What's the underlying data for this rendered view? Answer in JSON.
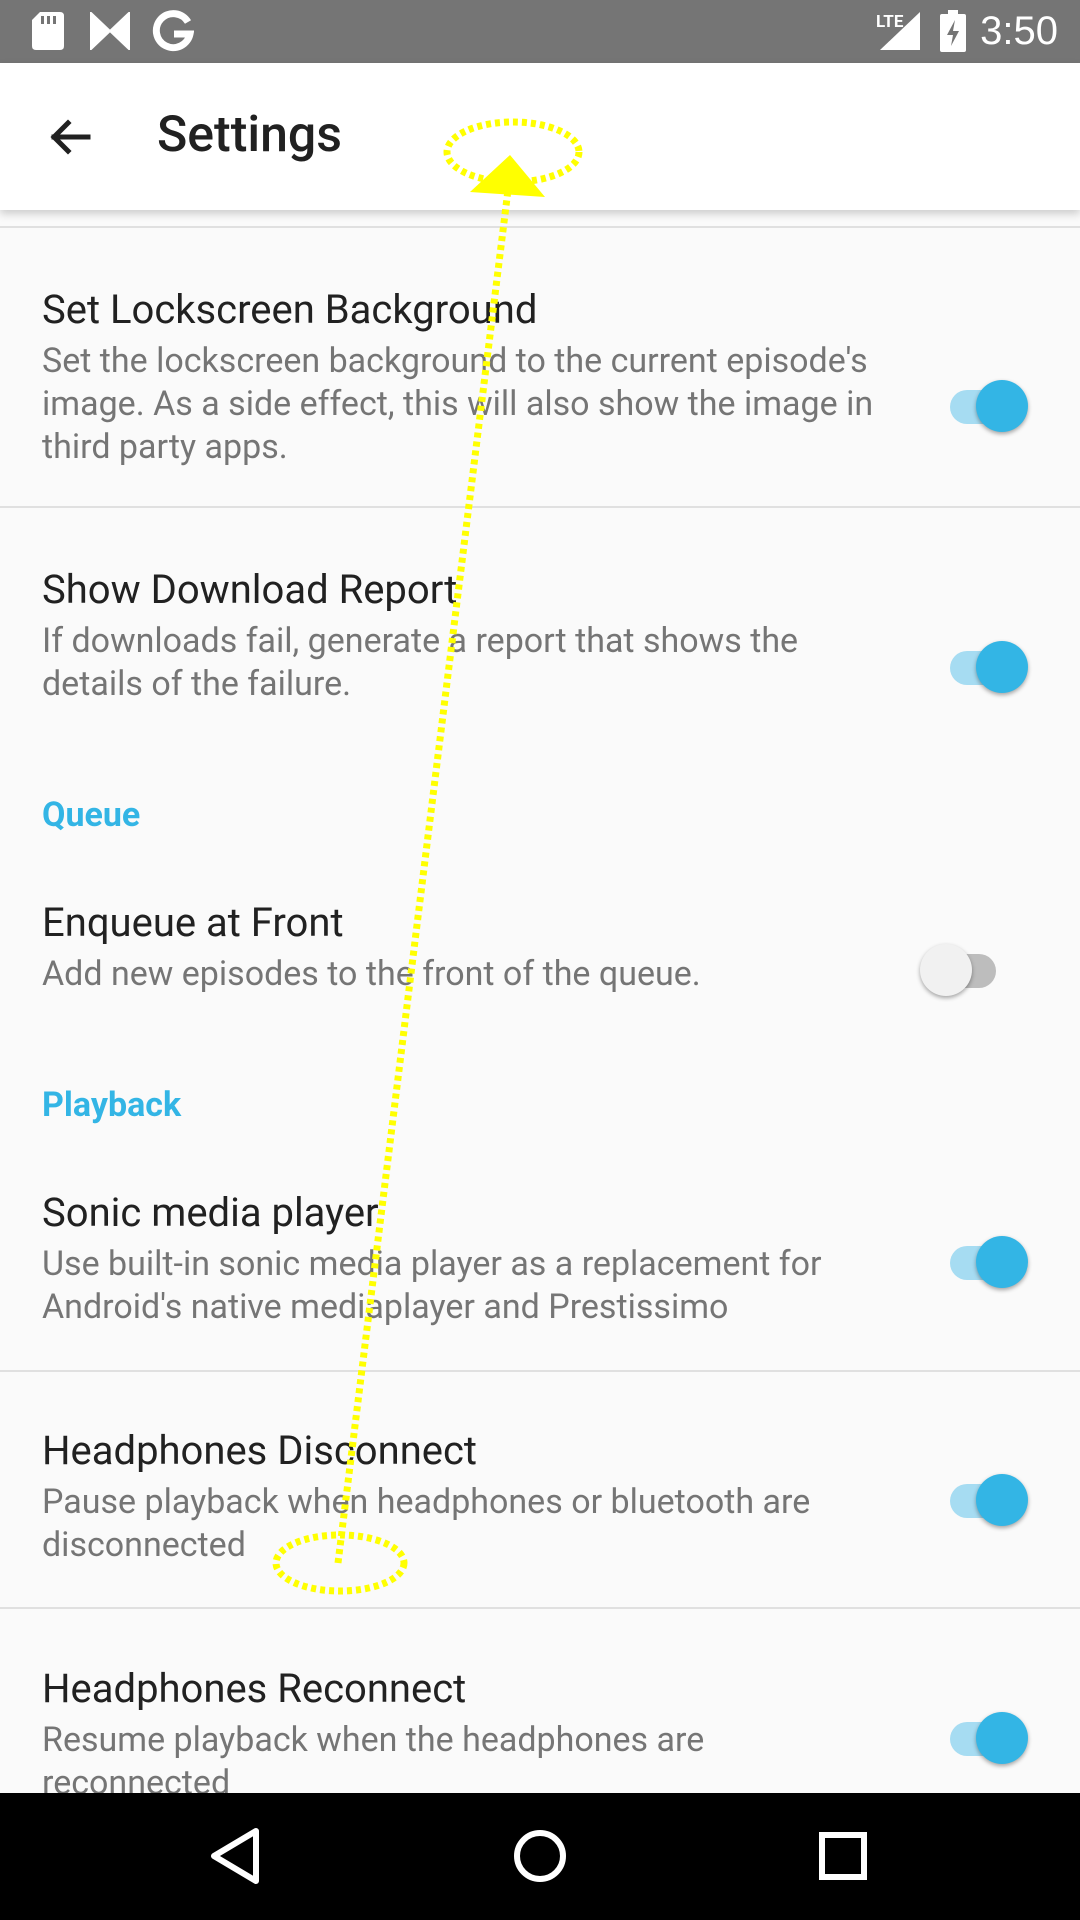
{
  "status_bar": {
    "time": "3:50",
    "network_label": "LTE",
    "icons": [
      "sd-card-icon",
      "n-logo-icon",
      "google-g-icon",
      "signal-icon",
      "battery-charging-icon"
    ]
  },
  "app_bar": {
    "title": "Settings",
    "back_icon": "arrow-back-icon"
  },
  "preferences": [
    {
      "title": "Set Lockscreen Background",
      "summary": "Set the lockscreen background to the current episode's image. As a side effect, this will also show the image in third party apps.",
      "checked": true
    },
    {
      "title": "Show Download Report",
      "summary": "If downloads fail, generate a report that shows the details of the failure.",
      "checked": true
    },
    {
      "category": "Queue"
    },
    {
      "title": "Enqueue at Front",
      "summary": "Add new episodes to the front of the queue.",
      "checked": false
    },
    {
      "category": "Playback"
    },
    {
      "title": "Sonic media player",
      "summary": "Use built-in sonic media player as a replacement for Android's native mediaplayer and Prestissimo",
      "checked": true
    },
    {
      "title": "Headphones Disconnect",
      "summary": "Pause playback when headphones or bluetooth are disconnected",
      "checked": true
    },
    {
      "title": "Headphones Reconnect",
      "summary": "Resume playback when the headphones are reconnected",
      "checked": true
    }
  ],
  "colors": {
    "accent": "#33b5e5",
    "gesture_overlay": "#ffff00",
    "status_bar": "#757575",
    "nav_bar": "#000000"
  },
  "nav_bar": {
    "icons": [
      "back-triangle-icon",
      "home-circle-icon",
      "recents-square-icon"
    ]
  },
  "gesture": {
    "type": "swipe-up"
  }
}
